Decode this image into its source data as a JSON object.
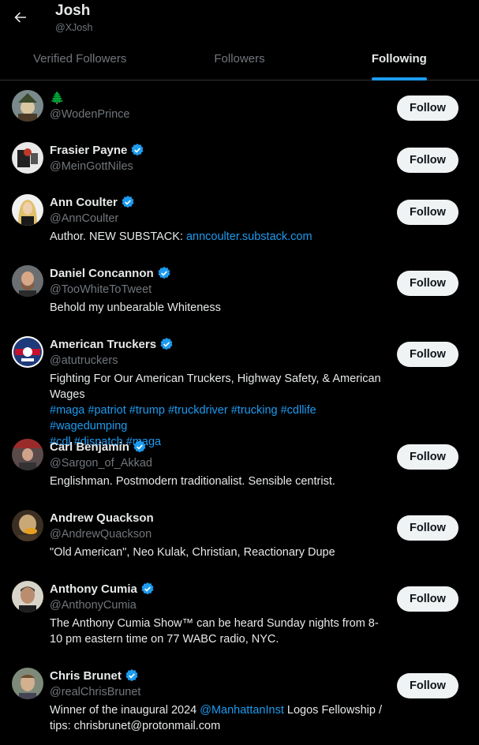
{
  "header": {
    "name": "Josh",
    "handle": "@XJosh"
  },
  "tabs": [
    {
      "label": "Verified Followers"
    },
    {
      "label": "Followers"
    },
    {
      "label": "Following"
    }
  ],
  "users": [
    {
      "name": "🌲",
      "handle": "@WodenPrince",
      "bio": "",
      "verified": false,
      "follow_label": "Follow"
    },
    {
      "name": "Frasier Payne",
      "handle": "@MeinGottNiles",
      "bio": "",
      "verified": true,
      "follow_label": "Follow"
    },
    {
      "name": "Ann Coulter",
      "handle": "@AnnCoulter",
      "bio_text": "Author. NEW SUBSTACK: ",
      "bio_link": "anncoulter.substack.com",
      "verified": true,
      "follow_label": "Follow"
    },
    {
      "name": "Daniel Concannon",
      "handle": "@TooWhiteToTweet",
      "bio": "Behold my unbearable Whiteness",
      "verified": true,
      "follow_label": "Follow"
    },
    {
      "name": "American Truckers",
      "handle": "@atutruckers",
      "bio_line1": "Fighting For Our American Truckers, Highway Safety, & American Wages",
      "hashtags": [
        "#maga",
        "#patriot",
        "#trump",
        "#truckdriver",
        "#trucking",
        "#cdllife",
        "#wagedumping",
        "#cdl",
        "#dispatch",
        "#maga"
      ],
      "verified": true,
      "follow_label": "Follow"
    },
    {
      "name": "Carl Benjamin",
      "handle": "@Sargon_of_Akkad",
      "bio": "Englishman. Postmodern traditionalist. Sensible centrist.",
      "verified": true,
      "follow_label": "Follow"
    },
    {
      "name": "Andrew Quackson",
      "handle": "@AndrewQuackson",
      "bio": "\"Old American\", Neo Kulak, Christian, Reactionary Dupe",
      "verified": false,
      "follow_label": "Follow"
    },
    {
      "name": "Anthony Cumia",
      "handle": "@AnthonyCumia",
      "bio": "The Anthony Cumia Show™ can be heard Sunday nights from 8-10 pm eastern time on 77 WABC radio, NYC.",
      "verified": true,
      "follow_label": "Follow"
    },
    {
      "name": "Chris Brunet",
      "handle": "@realChrisBrunet",
      "bio_pre": "Winner of the inaugural 2024 ",
      "bio_mention": "@ManhattanInst",
      "bio_post": " Logos Fellowship / tips: chrisbrunet@protonmail.com",
      "verified": true,
      "follow_label": "Follow"
    }
  ],
  "colors": {
    "accent": "#1d9bf0",
    "muted": "#71767b",
    "text": "#e7e9ea",
    "background": "#000000",
    "button": "#eff3f4"
  }
}
